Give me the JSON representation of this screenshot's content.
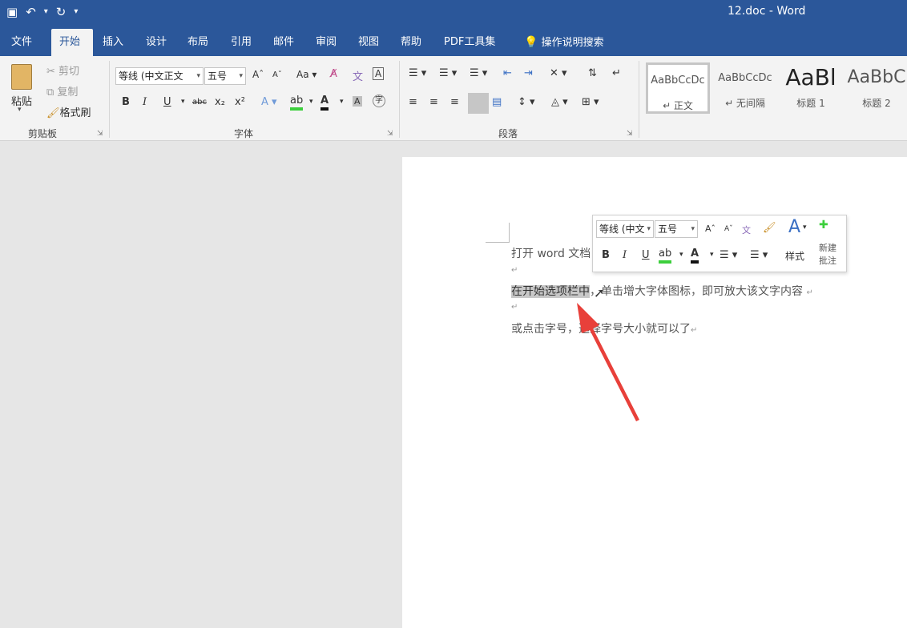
{
  "titlebar": {
    "doc_title": "12.doc - Word",
    "save_icon": "save-icon",
    "undo_icon": "undo-icon",
    "redo_icon": "redo-icon",
    "customize_icon": "customize-qat-icon"
  },
  "tabs": [
    {
      "label": "文件"
    },
    {
      "label": "开始"
    },
    {
      "label": "插入"
    },
    {
      "label": "设计"
    },
    {
      "label": "布局"
    },
    {
      "label": "引用"
    },
    {
      "label": "邮件"
    },
    {
      "label": "审阅"
    },
    {
      "label": "视图"
    },
    {
      "label": "帮助"
    },
    {
      "label": "PDF工具集"
    },
    {
      "label": "操作说明搜索"
    }
  ],
  "clipboard": {
    "paste": "粘贴",
    "cut": "剪切",
    "copy": "复制",
    "format_painter": "格式刷",
    "group": "剪贴板"
  },
  "font": {
    "font_name": "等线 (中文正文",
    "font_size": "五号",
    "change_case": "Aa",
    "bold": "B",
    "italic": "I",
    "underline": "U",
    "strike": "abc",
    "subscript": "x₂",
    "superscript": "x²",
    "font_color": "A",
    "group": "字体"
  },
  "paragraph": {
    "group": "段落"
  },
  "styles": [
    {
      "sample": "AaBbCcDc",
      "name": "↵ 正文"
    },
    {
      "sample": "AaBbCcDc",
      "name": "↵ 无间隔"
    },
    {
      "sample": "AaBl",
      "name": "标题 1"
    },
    {
      "sample": "AaBbC",
      "name": "标题 2"
    }
  ],
  "document": {
    "line1": "打开 word 文档",
    "line2_selected": "在开始选项栏中",
    "line2_rest": "，单击增大字体图标，即可放大该文字内容",
    "line3": "或点击字号，选择字号大小就可以了",
    "para_mark": "↵"
  },
  "mini_toolbar": {
    "font_name": "等线 (中文",
    "font_size": "五号",
    "bold": "B",
    "italic": "I",
    "underline": "U",
    "font_color": "A",
    "styles": "样式",
    "new_comment_line1": "新建",
    "new_comment_line2": "批注"
  },
  "colors": {
    "accent": "#2b579a",
    "arrow": "#e8403a",
    "highlight": "#c8c8c8"
  }
}
